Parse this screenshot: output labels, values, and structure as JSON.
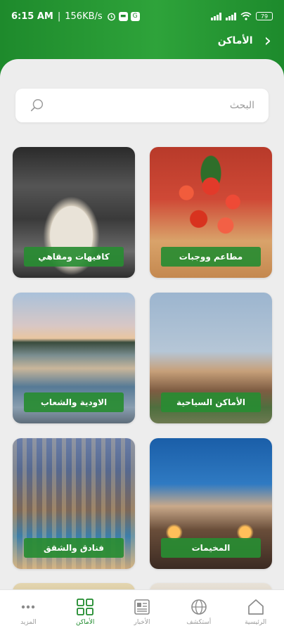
{
  "status_bar": {
    "time": "6:15 AM",
    "speed": "156KB/s",
    "battery": "79"
  },
  "top_bar": {
    "title": "الأماكن",
    "back_icon": "chevron-right-icon"
  },
  "search": {
    "placeholder": "البحث",
    "icon": "search-icon"
  },
  "categories": [
    {
      "label": "مطاعم ووجبات"
    },
    {
      "label": "كافيهات ومقاهي"
    },
    {
      "label": "الأماكن السياحية"
    },
    {
      "label": "الاودية والشعاب"
    },
    {
      "label": "المخيمات"
    },
    {
      "label": "فنادق والشقق"
    }
  ],
  "bottom_nav": [
    {
      "label": "الرئيسية",
      "icon": "home-icon",
      "active": false
    },
    {
      "label": "أستكشف",
      "icon": "globe-icon",
      "active": false
    },
    {
      "label": "الأخبار",
      "icon": "news-icon",
      "active": false
    },
    {
      "label": "الأماكن",
      "icon": "grid-icon",
      "active": true
    },
    {
      "label": "المزيد",
      "icon": "more-icon",
      "active": false
    }
  ],
  "colors": {
    "brand_green": "#1e8a2c",
    "label_green": "#288c32",
    "background": "#ededed"
  }
}
